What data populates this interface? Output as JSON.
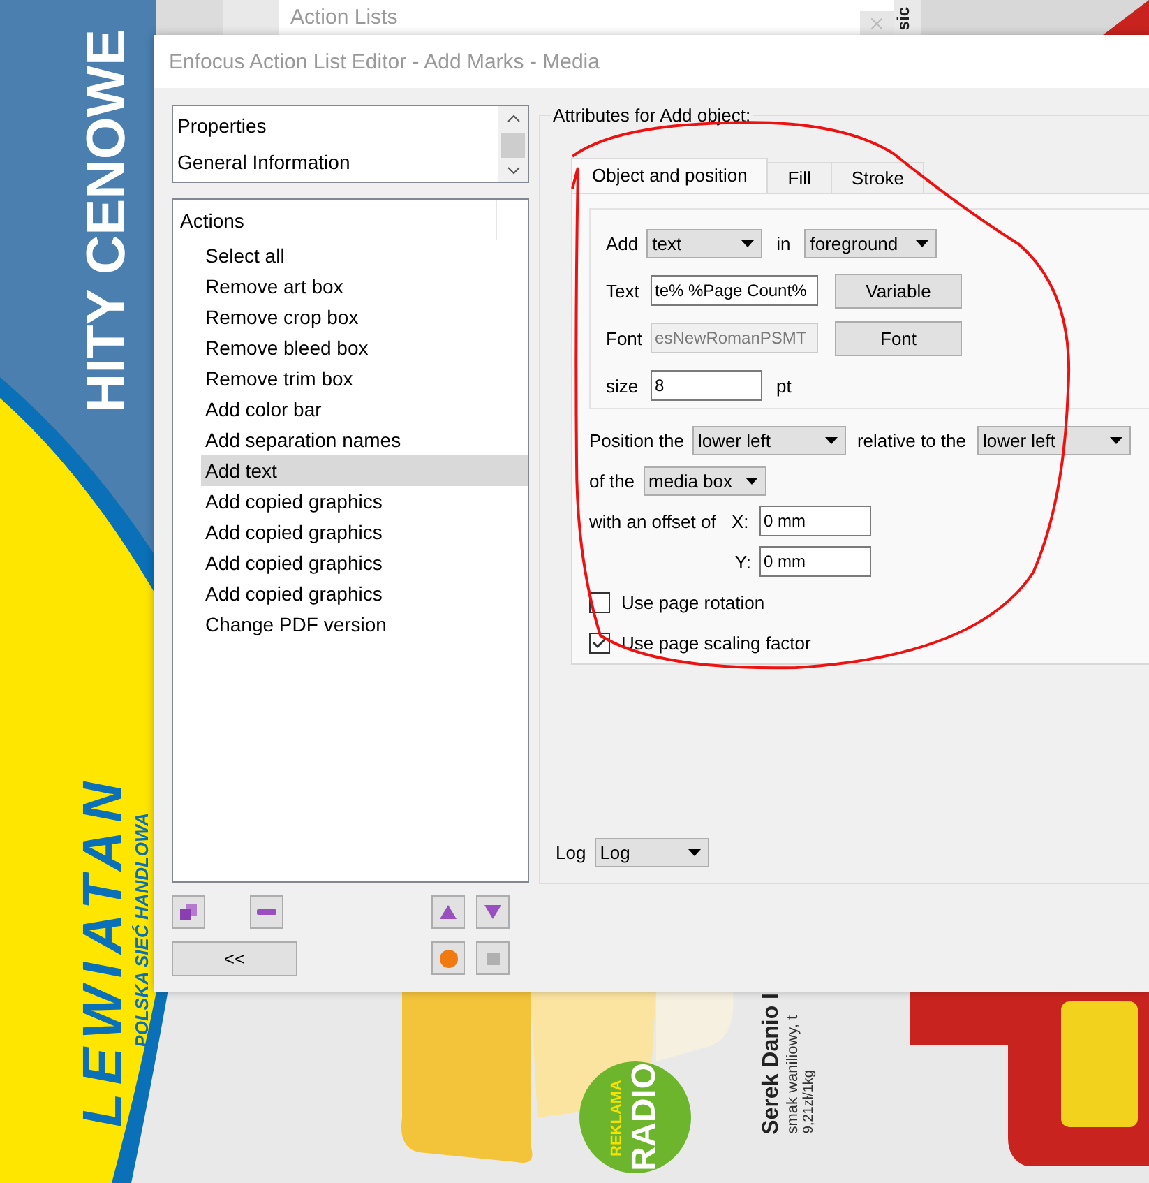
{
  "flyer": {
    "headline": "HITY CENOWE",
    "brand": "LEWIATAN",
    "brand_tagline": "POLSKA SIEĆ HANDLOWA",
    "badge_top": "REKLAMA",
    "badge_bottom": "RADIO",
    "product_name": "Serek Danio I",
    "product_desc": "smak waniliowy, t",
    "unit_price": "9,21zł/1kg",
    "edge_text": "sic"
  },
  "back_window": {
    "title": "Action Lists"
  },
  "window": {
    "title": "Enfocus Action List Editor - Add Marks - Media"
  },
  "sections": [
    "Properties",
    "General Information"
  ],
  "actions": {
    "header": "Actions",
    "items": [
      {
        "label": "Select all",
        "selected": false
      },
      {
        "label": "Remove art box",
        "selected": false
      },
      {
        "label": "Remove crop box",
        "selected": false
      },
      {
        "label": "Remove bleed box",
        "selected": false
      },
      {
        "label": "Remove trim box",
        "selected": false
      },
      {
        "label": "Add color bar",
        "selected": false
      },
      {
        "label": "Add separation names",
        "selected": false
      },
      {
        "label": "Add text",
        "selected": true
      },
      {
        "label": "Add copied graphics",
        "selected": false
      },
      {
        "label": "Add copied graphics",
        "selected": false
      },
      {
        "label": "Add copied graphics",
        "selected": false
      },
      {
        "label": "Add copied graphics",
        "selected": false
      },
      {
        "label": "Change PDF version",
        "selected": false
      }
    ]
  },
  "collapse_button": "<<",
  "attributes": {
    "legend": "Attributes for Add object:",
    "tabs": [
      {
        "label": "Object and position",
        "selected": true
      },
      {
        "label": "Fill",
        "selected": false
      },
      {
        "label": "Stroke",
        "selected": false
      }
    ],
    "add_label": "Add",
    "add_value": "text",
    "in_label": "in",
    "in_value": "foreground",
    "text_label": "Text",
    "text_value": "te% %Page Count%",
    "variable_button": "Variable",
    "font_label": "Font",
    "font_value": "esNewRomanPSMT",
    "font_disabled": true,
    "font_button": "Font",
    "size_label": "size",
    "size_value": "8",
    "size_unit": "pt",
    "position_label": "Position the",
    "position_value": "lower left",
    "relative_label": "relative to the",
    "relative_value": "lower left",
    "of_label": "of the",
    "of_value": "media box",
    "offset_label": "with an offset of",
    "x_label": "X:",
    "x_value": "0 mm",
    "y_label": "Y:",
    "y_value": "0 mm",
    "checkboxes": [
      {
        "label": "Use page rotation",
        "checked": false
      },
      {
        "label": "Use page scaling factor",
        "checked": true
      }
    ]
  },
  "log": {
    "label": "Log",
    "value": "Log"
  }
}
